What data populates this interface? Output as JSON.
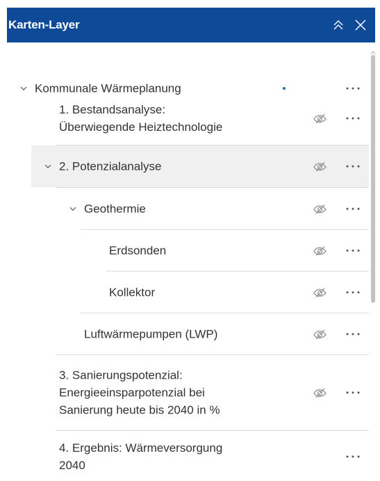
{
  "header": {
    "title": "Karten-Layer",
    "collapse_icon": "double-chevron-up-icon",
    "close_icon": "close-icon",
    "background": "#0f4a99"
  },
  "layers": [
    {
      "label": "Kommunale Wärmeplanung",
      "expanded": true,
      "has_indicator_dot": true
    },
    {
      "label_line1": "1. Bestandsanalyse:",
      "label_line2": "Überwiegende Heiztechnologie",
      "visible": false
    },
    {
      "label": "2. Potenzialanalyse",
      "expanded": true,
      "visible": false,
      "selected": true
    },
    {
      "label": "Geothermie",
      "expanded": true,
      "visible": false
    },
    {
      "label": "Erdsonden",
      "visible": false
    },
    {
      "label": "Kollektor",
      "visible": false
    },
    {
      "label": "Luftwärmepumpen (LWP)",
      "visible": false
    },
    {
      "label_line1": "3. Sanierungspotenzial:",
      "label_line2": "Energieeinsparpotenzial bei",
      "label_line3": "Sanierung heute bis 2040 in %",
      "visible": false
    },
    {
      "label_line1": "4. Ergebnis: Wärmeversorgung",
      "label_line2": "2040"
    }
  ],
  "icons": {
    "expand": "chevron-down-icon",
    "visibility": "eye-off-icon",
    "options": "more-options-icon"
  },
  "colors": {
    "accent": "#1e6fc1",
    "selected_row": "#f0f0f0"
  }
}
